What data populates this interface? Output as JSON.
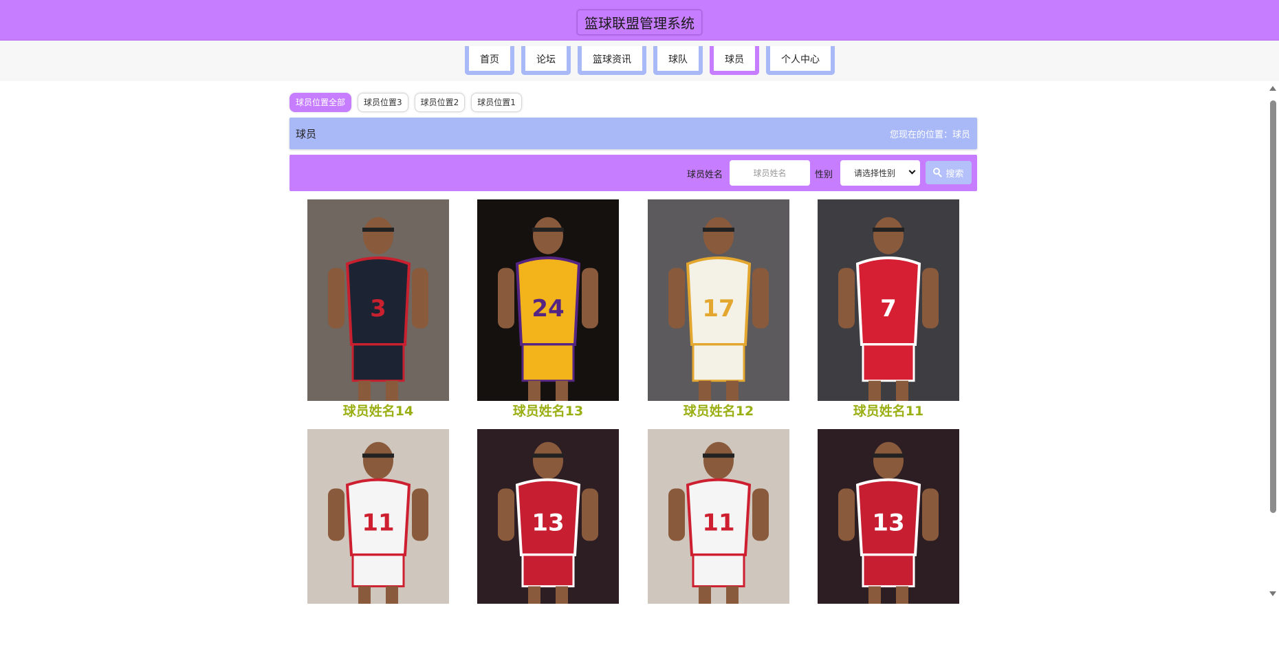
{
  "header": {
    "title": "篮球联盟管理系统"
  },
  "nav": {
    "items": [
      {
        "label": "首页",
        "name": "nav-home"
      },
      {
        "label": "论坛",
        "name": "nav-forum"
      },
      {
        "label": "篮球资讯",
        "name": "nav-news"
      },
      {
        "label": "球队",
        "name": "nav-teams"
      },
      {
        "label": "球员",
        "name": "nav-players"
      },
      {
        "label": "个人中心",
        "name": "nav-profile"
      }
    ],
    "active": "球员"
  },
  "filters": {
    "tabs": [
      "球员位置全部",
      "球员位置3",
      "球员位置2",
      "球员位置1"
    ],
    "active": "球员位置全部"
  },
  "location": {
    "title": "球员",
    "path": "您现在的位置：球员"
  },
  "search": {
    "name_label": "球员姓名",
    "name_placeholder": "球员姓名",
    "gender_label": "性别",
    "gender_selected": "请选择性别",
    "button_label": "搜索"
  },
  "players": [
    {
      "name": "球员姓名14",
      "jersey_color": "#1c2433",
      "trim_color": "#c8202e",
      "number": "3"
    },
    {
      "name": "球员姓名13",
      "jersey_color": "#f2b31b",
      "trim_color": "#552583",
      "number": "24"
    },
    {
      "name": "球员姓名12",
      "jersey_color": "#f4f1e6",
      "trim_color": "#e3a72f",
      "number": "17"
    },
    {
      "name": "球员姓名11",
      "jersey_color": "#d71f34",
      "trim_color": "#ffffff",
      "number": "7"
    },
    {
      "name": "",
      "jersey_color": "#f5f5f5",
      "trim_color": "#cd1f2f",
      "number": "11"
    },
    {
      "name": "",
      "jersey_color": "#c81e32",
      "trim_color": "#ffffff",
      "number": "13"
    },
    {
      "name": "",
      "jersey_color": "#f5f5f5",
      "trim_color": "#cd1f2f",
      "number": "11"
    },
    {
      "name": "",
      "jersey_color": "#c81e32",
      "trim_color": "#ffffff",
      "number": "13"
    }
  ],
  "colors": {
    "primary": "#c77dff",
    "secondary": "#a9b8f7",
    "player_name": "#9aaf14"
  }
}
